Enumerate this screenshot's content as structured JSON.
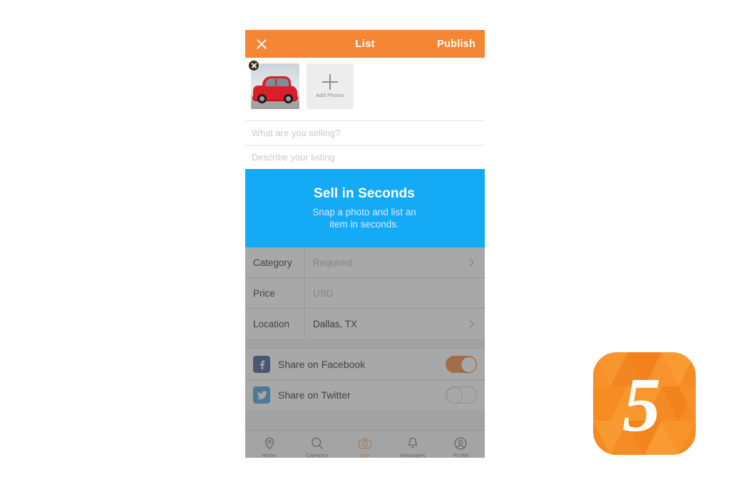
{
  "header": {
    "close_icon": "close-icon",
    "title": "List",
    "publish_label": "Publish",
    "background_color": "#F58634"
  },
  "photos": {
    "thumbnail_alt": "red car photo",
    "delete_icon": "close-circle-icon",
    "add_icon": "plus-icon",
    "add_label": "Add Photos"
  },
  "fields": {
    "title_placeholder": "What are you selling?",
    "description_placeholder": "Describe your listing"
  },
  "promo": {
    "title": "Sell in Seconds",
    "subtitle": "Snap a photo and list an item in seconds.",
    "background_color": "#14AAF5"
  },
  "form": {
    "rows": [
      {
        "label": "Category",
        "value": "Required",
        "is_placeholder": true,
        "has_chevron": true
      },
      {
        "label": "Price",
        "value": "USD",
        "is_placeholder": true,
        "has_chevron": false
      },
      {
        "label": "Location",
        "value": "Dallas, TX",
        "is_placeholder": false,
        "has_chevron": true
      }
    ]
  },
  "social": {
    "rows": [
      {
        "label": "Share on Facebook",
        "icon": "facebook-icon",
        "icon_color": "#3A5795",
        "toggle_on": true
      },
      {
        "label": "Share on Twitter",
        "icon": "twitter-icon",
        "icon_color": "#3FA0DC",
        "toggle_on": false
      }
    ],
    "toggle_on_color": "#F58634"
  },
  "tabbar": {
    "items": [
      {
        "label": "Home",
        "icon": "location-pin-icon",
        "active": false
      },
      {
        "label": "Category",
        "icon": "search-icon",
        "active": false
      },
      {
        "label": "List",
        "icon": "camera-icon",
        "active": true
      },
      {
        "label": "Messages",
        "icon": "bell-icon",
        "active": false
      },
      {
        "label": "Profile",
        "icon": "person-circle-icon",
        "active": false
      }
    ],
    "active_color": "#F58634"
  },
  "logo": {
    "name": "app-logo",
    "glyph": "5",
    "background_color": "#F7941E"
  }
}
